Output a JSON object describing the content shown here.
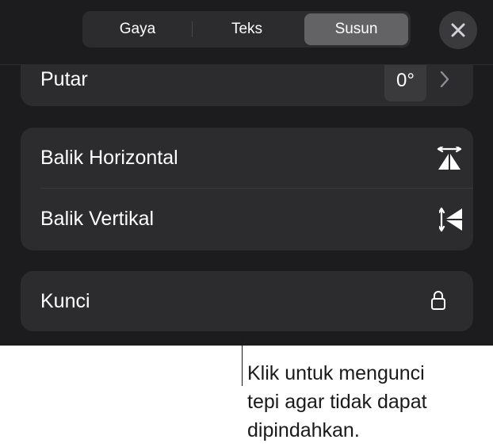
{
  "tabs": [
    {
      "label": "Gaya",
      "selected": false
    },
    {
      "label": "Teks",
      "selected": false
    },
    {
      "label": "Susun",
      "selected": true
    }
  ],
  "close": {
    "icon": "close-x-icon"
  },
  "rotate": {
    "label": "Putar",
    "value": "0°",
    "icon": "chevron-right-icon"
  },
  "flip": {
    "horizontal": {
      "label": "Balik Horizontal",
      "icon": "flip-horizontal-icon"
    },
    "vertical": {
      "label": "Balik Vertikal",
      "icon": "flip-vertical-icon"
    }
  },
  "lock": {
    "label": "Kunci",
    "icon": "lock-icon"
  },
  "callout": {
    "lines": [
      "Klik untuk mengunci",
      "tepi agar tidak dapat",
      "dipindahkan."
    ]
  },
  "colors": {
    "panel_bg": "#1c1c1e",
    "group_bg": "#2c2c2e",
    "selected_segment": "#636366",
    "text": "#ffffff"
  }
}
